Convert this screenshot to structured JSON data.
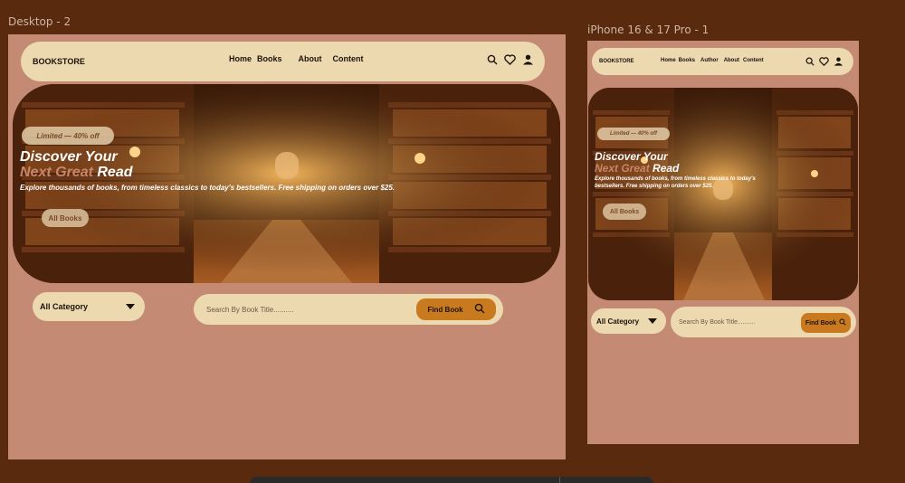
{
  "frames": {
    "desktop": {
      "label": "Desktop - 2"
    },
    "mobile": {
      "label": "iPhone 16 & 17 Pro - 1"
    }
  },
  "nav": {
    "brand": "BOOKSTORE",
    "desktop_links": [
      "Home",
      "Books",
      "About",
      "Content"
    ],
    "mobile_links": [
      "Home",
      "Books",
      "Author",
      "About",
      "Content"
    ],
    "icons": [
      "search-icon",
      "heart-icon",
      "user-icon"
    ]
  },
  "hero": {
    "badge": "Limited — 40% off",
    "title_line1": "Discover Your",
    "title_accent": "Next Great",
    "title_end": "Read",
    "subtitle": "Explore thousands of books, from timeless classics to today's bestsellers. Free shipping on orders over $25.",
    "button": "All Books"
  },
  "filter": {
    "category_label": "All Category",
    "search_placeholder": "Search By Book Title..........",
    "find_button": "Find Book"
  },
  "colors": {
    "background": "#5a2a0e",
    "artboard": "#c48a74",
    "nav_bg": "#ecd9b0",
    "accent": "#c97a1e",
    "title_accent": "#c8866a"
  }
}
